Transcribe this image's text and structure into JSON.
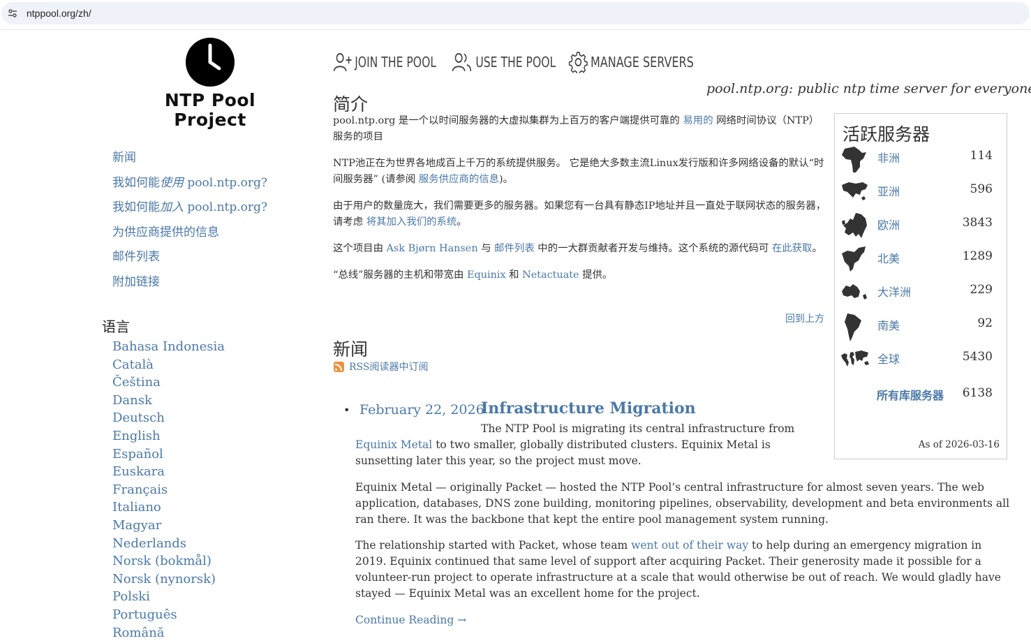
{
  "browser": {
    "url": "ntppool.org/zh/"
  },
  "logo": {
    "line1": "NTP Pool",
    "line2": "Project"
  },
  "sidebar": {
    "items": [
      {
        "label": "新闻"
      },
      {
        "pre": "我如何能",
        "em": "使用",
        "post": " pool.ntp.org?"
      },
      {
        "pre": "我如何能",
        "em": "加入",
        "post": " pool.ntp.org?"
      },
      {
        "label": "为供应商提供的信息"
      },
      {
        "label": "邮件列表"
      },
      {
        "label": "附加链接"
      }
    ],
    "languages_title": "语言",
    "languages": [
      "Bahasa Indonesia",
      "Català",
      "Čeština",
      "Dansk",
      "Deutsch",
      "English",
      "Español",
      "Euskara",
      "Français",
      "Italiano",
      "Magyar",
      "Nederlands",
      "Norsk (bokmål)",
      "Norsk (nynorsk)",
      "Polski",
      "Português",
      "Română"
    ]
  },
  "nav": {
    "join": "JOIN THE POOL",
    "use": "USE THE POOL",
    "manage": "MANAGE SERVERS"
  },
  "tagline": "pool.ntp.org: public ntp time server for everyone",
  "intro": {
    "title": "简介",
    "p1_a": "pool.ntp.org 是一个以时间服务器的大虚拟集群为上百万的客户端提供可靠的 ",
    "p1_link": "易用的",
    "p1_b": " 网络时间协议（NTP）服务的项目",
    "p2_a": "NTP池正在为世界各地成百上千万的系统提供服务。 它是绝大多数主流Linux发行版和许多网络设备的默认“时间服务器” (请参阅 ",
    "p2_link": "服务供应商的信息",
    "p2_b": ")。",
    "p3_a": "由于用户的数量庞大，我们需要更多的服务器。如果您有一台具有静态IP地址并且一直处于联网状态的服务器，请考虑 ",
    "p3_link": "将其加入我们的系统",
    "p3_b": "。",
    "p4_a": "这个项目由 ",
    "p4_link1": "Ask Bjørn Hansen",
    "p4_b": " 与 ",
    "p4_link2": "邮件列表",
    "p4_c": " 中的一大群贡献者开发与维持。这个系统的源代码可 ",
    "p4_link3": "在此获取",
    "p4_d": "。",
    "p5_a": "“总线”服务器的主机和带宽由 ",
    "p5_link1": "Equinix",
    "p5_b": " 和 ",
    "p5_link2": "Netactuate",
    "p5_c": " 提供。",
    "back_to_top": "回到上方"
  },
  "news": {
    "title": "新闻",
    "rss": "RSS阅读器中订阅",
    "bullet": "•",
    "date": "February 22, 2026",
    "headline": "Infrastructure Migration",
    "p1_a": "The NTP Pool is migrating its central infrastructure from ",
    "p1_link": "Equinix Metal",
    "p1_b": " to two smaller, globally distributed clusters. Equinix Metal is sunsetting later this year, so the project must move.",
    "p2": "Equinix Metal — originally Packet — hosted the NTP Pool’s central infrastructure for almost seven years. The web application, databases, DNS zone building, monitoring pipelines, observability, development and beta environments all ran there. It was the backbone that kept the entire pool management system running.",
    "p3_a": "The relationship started with Packet, whose team ",
    "p3_link": "went out of their way",
    "p3_b": " to help during an emergency migration in 2019. Equinix continued that same level of support after acquiring Packet. Their generosity made it possible for a volunteer-run project to operate infrastructure at a scale that would otherwise be out of reach. We would gladly have stayed — Equinix Metal was an excellent home for the project.",
    "continue": "Continue Reading →"
  },
  "servers": {
    "title": "活跃服务器",
    "zones": [
      {
        "name": "非洲",
        "count": "114",
        "icon": "africa-map-icon"
      },
      {
        "name": "亚洲",
        "count": "596",
        "icon": "asia-map-icon"
      },
      {
        "name": "欧洲",
        "count": "3843",
        "icon": "europe-map-icon"
      },
      {
        "name": "北美",
        "count": "1289",
        "icon": "north-america-map-icon"
      },
      {
        "name": "大洋洲",
        "count": "229",
        "icon": "oceania-map-icon"
      },
      {
        "name": "南美",
        "count": "92",
        "icon": "south-america-map-icon"
      },
      {
        "name": "全球",
        "count": "5430",
        "icon": "world-map-icon"
      }
    ],
    "total_label": "所有库服务器",
    "total_count": "6138",
    "as_of": "As of 2026-03-16"
  }
}
